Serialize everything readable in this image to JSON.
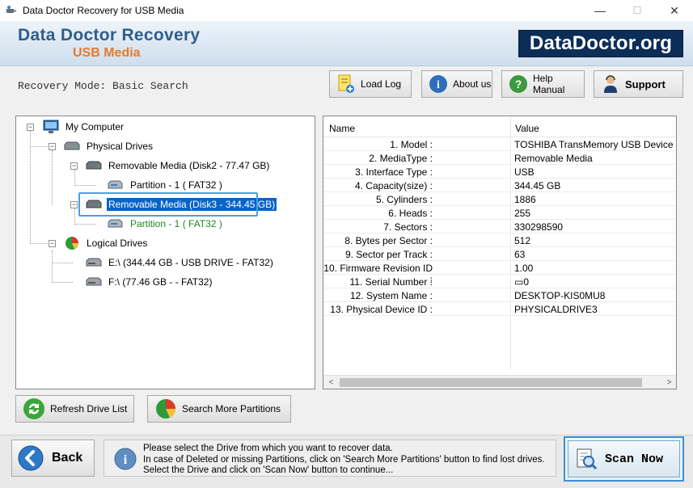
{
  "window": {
    "title": "Data Doctor Recovery for USB Media",
    "minimize": "—",
    "maximize": "☐",
    "close": "✕"
  },
  "banner": {
    "product_line1": "Data Doctor Recovery",
    "product_line2": "USB Media",
    "brand": "DataDoctor.org"
  },
  "toolbar": {
    "mode_text": "Recovery Mode: Basic Search",
    "load_log": "Load Log",
    "about_us": "About us",
    "help_manual": "Help Manual",
    "support": "Support"
  },
  "tree": {
    "my_computer": "My Computer",
    "physical_drives": "Physical Drives",
    "disk2": "Removable Media (Disk2 - 77.47 GB)",
    "disk2_partition": "Partition - 1 ( FAT32 )",
    "disk3": "Removable Media (Disk3 - 344.45 GB)",
    "disk3_partition": "Partition - 1 ( FAT32 )",
    "logical_drives": "Logical Drives",
    "drive_e": "E:\\ (344.44 GB - USB DRIVE - FAT32)",
    "drive_f": "F:\\ (77.46 GB -  - FAT32)"
  },
  "properties": {
    "col_name": "Name",
    "col_value": "Value",
    "rows": [
      {
        "name": "1. Model :",
        "value": "TOSHIBA TransMemory USB Device"
      },
      {
        "name": "2. MediaType :",
        "value": "Removable Media"
      },
      {
        "name": "3. Interface Type :",
        "value": "USB"
      },
      {
        "name": "4. Capacity(size) :",
        "value": "344.45 GB"
      },
      {
        "name": "5. Cylinders :",
        "value": "1886"
      },
      {
        "name": "6. Heads :",
        "value": "255"
      },
      {
        "name": "7. Sectors :",
        "value": "330298590"
      },
      {
        "name": "8. Bytes per Sector :",
        "value": "512"
      },
      {
        "name": "9. Sector per Track :",
        "value": "63"
      },
      {
        "name": "10. Firmware Revision ID :",
        "value": "1.00"
      },
      {
        "name": "11. Serial Number :",
        "value": "▭0"
      },
      {
        "name": "12. System Name :",
        "value": "DESKTOP-KIS0MU8"
      },
      {
        "name": "13. Physical Device ID :",
        "value": "PHYSICALDRIVE3"
      }
    ]
  },
  "actions": {
    "refresh": "Refresh Drive List",
    "search_more": "Search More Partitions",
    "back": "Back",
    "scan_now": "Scan Now"
  },
  "info": {
    "line1": "Please select the Drive from which you want to recover data.",
    "line2": "In case of Deleted or missing Partitions, click on 'Search More Partitions' button to find lost drives.",
    "line3": "Select the Drive and click on 'Scan Now' button to continue..."
  },
  "colors": {
    "selection": "#0a64c8",
    "partition_green": "#1e8a1e",
    "brand_bg": "#0c2d57",
    "product_blue": "#2f5d8a",
    "product_orange": "#e57b27"
  }
}
